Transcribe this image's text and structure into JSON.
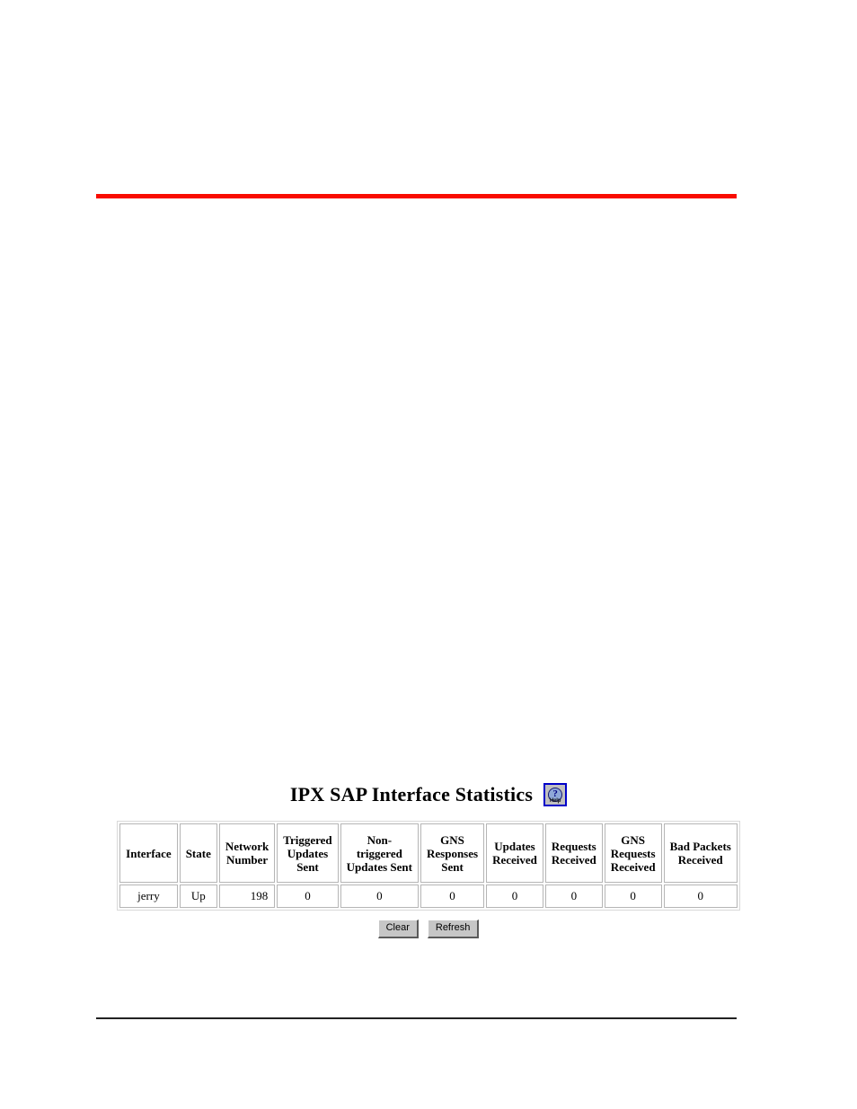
{
  "page": {
    "background": "#ffffff",
    "top_rule_color": "#f90c00",
    "bottom_rule_color": "#222222"
  },
  "heading": {
    "title": "IPX SAP Interface Statistics",
    "help_button": {
      "icon": "question-mark-help-icon",
      "glyph": "?",
      "label": "Help",
      "border_color": "#0000c8",
      "face_color": "#c0c0c0"
    }
  },
  "table": {
    "columns": [
      "Interface",
      "State",
      "Network Number",
      "Triggered Updates Sent",
      "Non-triggered Updates Sent",
      "GNS Responses Sent",
      "Updates Received",
      "Requests Received",
      "GNS Requests Received",
      "Bad Packets Received"
    ],
    "column_lines": [
      [
        "Interface"
      ],
      [
        "State"
      ],
      [
        "Network",
        "Number"
      ],
      [
        "Triggered",
        "Updates",
        "Sent"
      ],
      [
        "Non-",
        "triggered",
        "Updates Sent"
      ],
      [
        "GNS",
        "Responses",
        "Sent"
      ],
      [
        "Updates",
        "Received"
      ],
      [
        "Requests",
        "Received"
      ],
      [
        "GNS",
        "Requests",
        "Received"
      ],
      [
        "Bad Packets",
        "Received"
      ]
    ],
    "rows": [
      {
        "interface": "jerry",
        "state": "Up",
        "network_number": "198",
        "triggered_updates_sent": "0",
        "non_triggered_updates_sent": "0",
        "gns_responses_sent": "0",
        "updates_received": "0",
        "requests_received": "0",
        "gns_requests_received": "0",
        "bad_packets_received": "0"
      }
    ]
  },
  "actions": {
    "clear_label": "Clear",
    "refresh_label": "Refresh"
  }
}
